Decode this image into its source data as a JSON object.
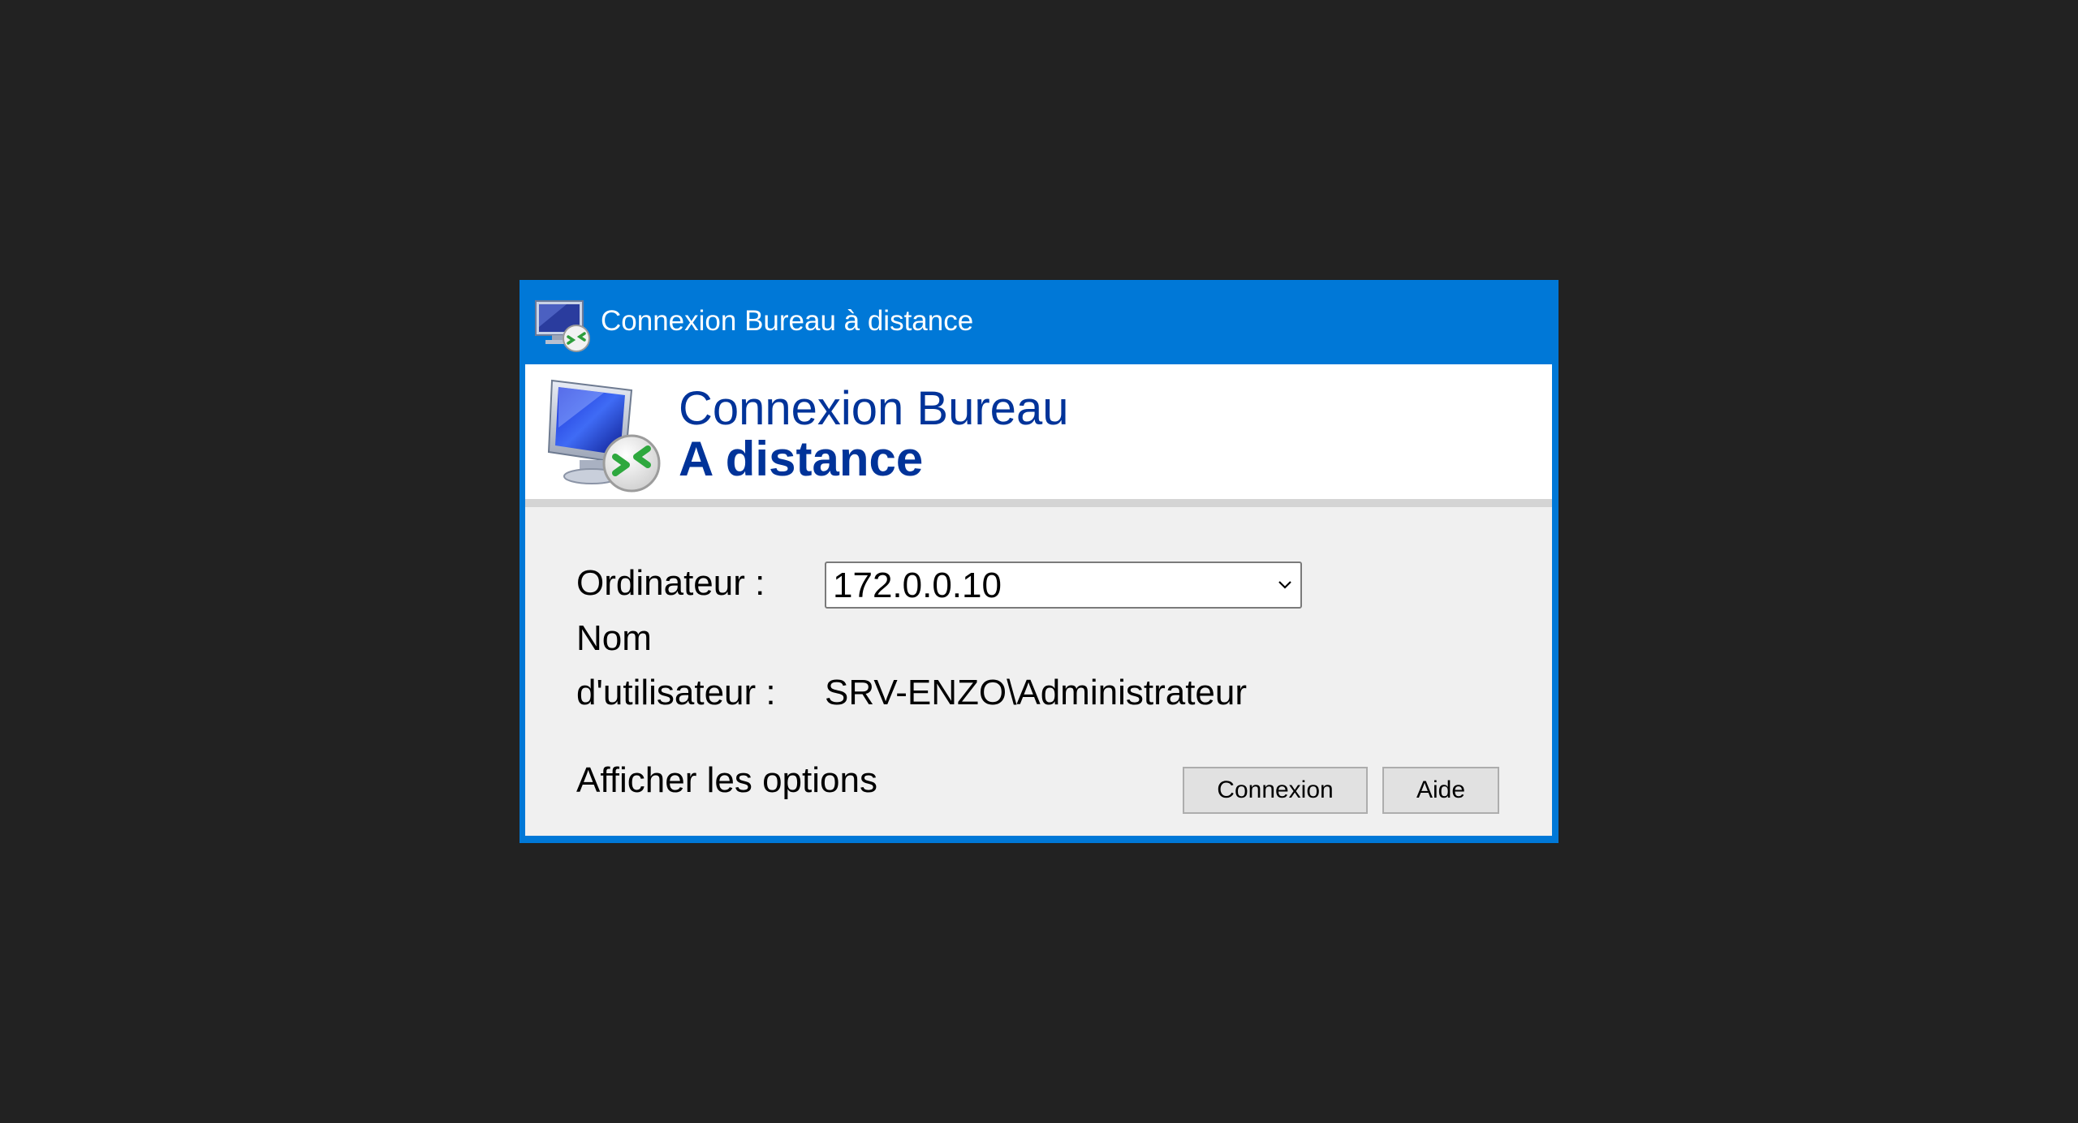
{
  "window": {
    "title": "Connexion Bureau à distance",
    "icon": "remote-desktop-icon"
  },
  "header": {
    "line1": "Connexion Bureau",
    "line2": "A distance",
    "icon": "remote-desktop-icon"
  },
  "form": {
    "computer_label": "Ordinateur :",
    "computer_value": "172.0.0.10",
    "username_label_line1": "Nom",
    "username_label_line2": "d'utilisateur :",
    "username_value": "SRV-ENZO\\Administrateur"
  },
  "footer": {
    "show_options": "Afficher les options",
    "connect_button": "Connexion",
    "help_button": "Aide"
  },
  "colors": {
    "titlebar": "#0078d7",
    "header_text": "#003399",
    "background": "#222222"
  }
}
